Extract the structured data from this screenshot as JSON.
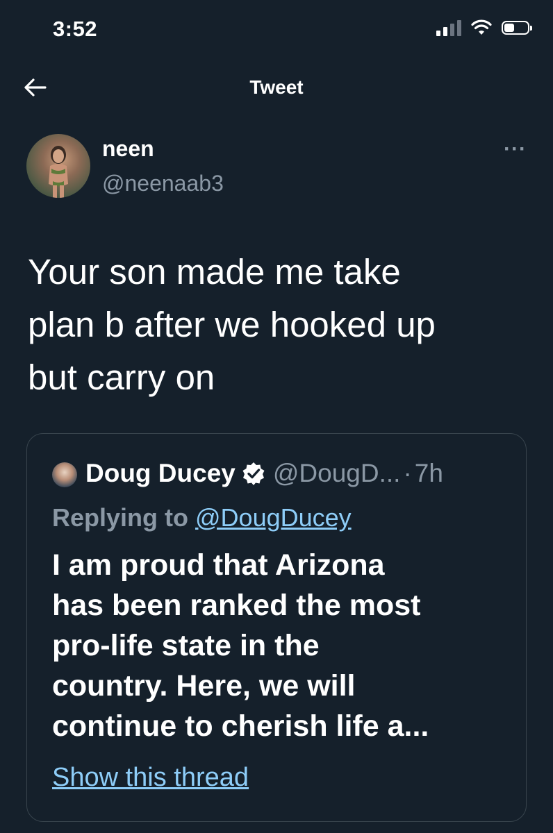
{
  "status_bar": {
    "time": "3:52",
    "icons": [
      "cellular-signal-icon",
      "wifi-icon",
      "battery-icon"
    ]
  },
  "header": {
    "back_icon": "arrow-left-icon",
    "title": "Tweet"
  },
  "tweet": {
    "author": {
      "name": "neen",
      "handle": "@neenaab3"
    },
    "more_label": "···",
    "lines": [
      "Your son made me take",
      "plan b after we hooked up",
      "but carry on"
    ]
  },
  "quote": {
    "name": "Doug Ducey",
    "verified_icon": "verified-badge-icon",
    "handle": "@DougD...",
    "separator": "·",
    "time": "7h",
    "replying_prefix": "Replying to",
    "replying_handle": "@DougDucey",
    "lines": [
      "I am proud that Arizona",
      "has been ranked the most",
      "pro-life state in the",
      "country. Here, we will",
      "continue to cherish life a..."
    ],
    "show_thread": "Show this thread"
  },
  "colors": {
    "background": "#15202b",
    "text_primary": "#ffffff",
    "text_secondary": "#8b98a5",
    "link": "#8ecdf8",
    "card_border": "#38444d"
  }
}
